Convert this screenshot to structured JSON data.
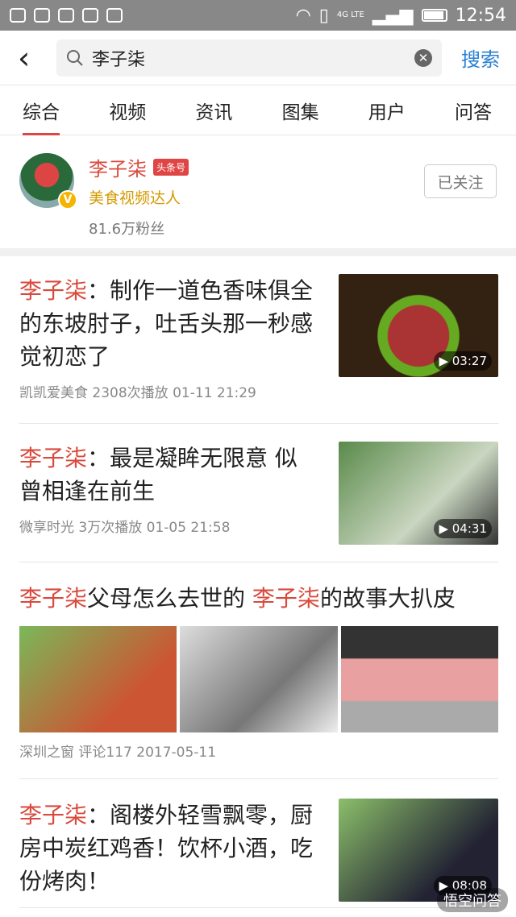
{
  "status_bar": {
    "time": "12:54",
    "network": "4G LTE"
  },
  "search": {
    "query": "李子柒",
    "button": "搜索"
  },
  "tabs": [
    "综合",
    "视频",
    "资讯",
    "图集",
    "用户",
    "问答"
  ],
  "user_card": {
    "name": "李子柒",
    "badge": "头条号",
    "desc": "美食视频达人",
    "fans": "81.6万粉丝",
    "follow": "已关注"
  },
  "results": [
    {
      "hl": "李子柒",
      "title": "：制作一道色香味俱全的东坡肘子，吐舌头那一秒感觉初恋了",
      "meta": "凯凯爱美食  2308次播放  01-11 21:29",
      "duration": "03:27"
    },
    {
      "hl": "李子柒",
      "title": "：最是凝眸无限意 似曾相逢在前生",
      "meta": "微享时光  3万次播放  01-05 21:58",
      "duration": "04:31"
    },
    {
      "hl1": "李子柒",
      "mid": "父母怎么去世的 ",
      "hl2": "李子柒",
      "end": "的故事大扒皮",
      "meta": "深圳之窗  评论117  2017-05-11"
    },
    {
      "hl": "李子柒",
      "title": "：阁楼外轻雪飘零，厨房中炭红鸡香！饮杯小酒，吃份烤肉！",
      "duration": "08:08"
    }
  ],
  "watermark": "悟空问答",
  "colors": {
    "accent": "#d94a3c",
    "link": "#2a7fd4"
  }
}
